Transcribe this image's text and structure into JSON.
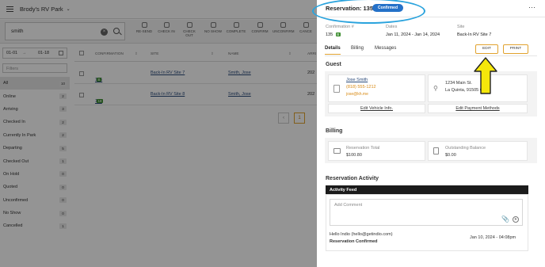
{
  "app": {
    "park_name": "Brody's RV Park"
  },
  "search": {
    "value": "smith",
    "clear_glyph": "×"
  },
  "actions": [
    "RE-SEND",
    "CHECK IN",
    "CHECK OUT",
    "NO SHOW",
    "COMPLETE",
    "CONFIRM",
    "UNCONFIRM",
    "CANCE"
  ],
  "date_range": {
    "start": "01-01",
    "end": "01-18"
  },
  "filter": {
    "placeholder": "Filters"
  },
  "sidebar": {
    "items": [
      {
        "label": "All",
        "count": "10",
        "active": true
      },
      {
        "label": "Online",
        "count": "2"
      },
      {
        "label": "Arriving",
        "count": "3"
      },
      {
        "label": "Checked In",
        "count": "2"
      },
      {
        "label": "Currently In Park",
        "count": "2"
      },
      {
        "label": "Departing",
        "count": "5"
      },
      {
        "label": "Checked Out",
        "count": "1"
      },
      {
        "label": "On Hold",
        "count": "0"
      },
      {
        "label": "Quoted",
        "count": "0"
      },
      {
        "label": "Unconfirmed",
        "count": "0"
      },
      {
        "label": "No Show",
        "count": "0"
      },
      {
        "label": "Cancelled",
        "count": "1"
      }
    ]
  },
  "table": {
    "headers": [
      "CONFIRMATION",
      "SITE",
      "NAME",
      "ARRI"
    ],
    "rows": [
      {
        "confirmation": "135",
        "badge": "B",
        "site": "Back-In RV Site 7",
        "name": "Smith, Jose",
        "arrival": "202"
      },
      {
        "confirmation": "110",
        "badge": "18",
        "site": "Back-In RV Site 8",
        "name": "Smith, Jose",
        "arrival": "202"
      }
    ],
    "page": "1"
  },
  "drawer": {
    "title": "Reservation: 135",
    "status": "Confirmed",
    "info": {
      "confirmation_label": "Confirmation #",
      "confirmation_value": "135",
      "confirmation_badge": "B",
      "dates_label": "Dates",
      "dates_value": "Jan 11, 2024 - Jan 14, 2024",
      "site_label": "Site",
      "site_value": "Back-In RV Site 7"
    },
    "tabs": [
      "Details",
      "Billing",
      "Messages"
    ],
    "buttons": {
      "edit": "EDIT",
      "print": "PRINT"
    },
    "guest": {
      "heading": "Guest",
      "name": "Jose Smith",
      "phone": "(818) 555-1212",
      "email": "jose@kh.me",
      "address1": "1234 Main St.",
      "address2": "La Quinta, 91505 CA",
      "edit_vehicle": "Edit Vehicle Info.",
      "edit_payment": "Edit Payment Methods"
    },
    "billing": {
      "heading": "Billing",
      "total_label": "Reservation Total",
      "total_value": "$100.80",
      "balance_label": "Outstanding Balance",
      "balance_value": "$0.00"
    },
    "activity": {
      "heading": "Reservation Activity",
      "feed_label": "Activity Feed",
      "comment_placeholder": "Add Comment",
      "entry_author": "Hello Indio (hello@getindio.com)",
      "entry_date": "Jan 10, 2024 - 04:08pm",
      "entry_text": "Reservation Confirmed"
    }
  },
  "colors": {
    "accent": "#e1a22e",
    "status_blue": "#2471c8",
    "badge_green": "#3c8d2f",
    "annotation_ellipse": "#2aa3dd",
    "annotation_arrow": "#f5e70b"
  }
}
